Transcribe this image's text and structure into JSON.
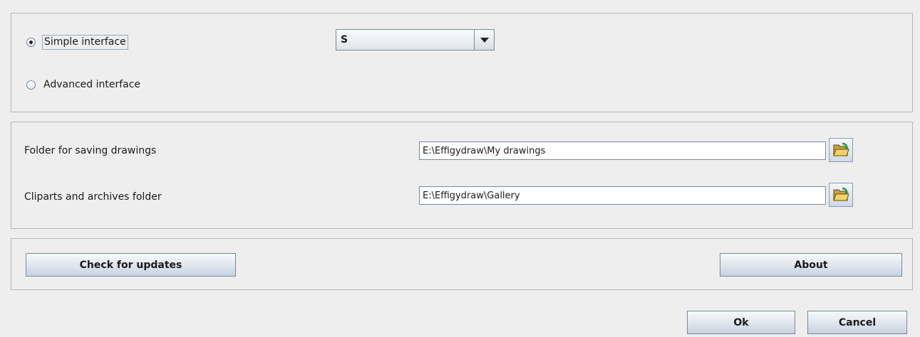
{
  "interface": {
    "simple_label": "Simple interface",
    "advanced_label": "Advanced interface",
    "selected": "simple",
    "size_select": {
      "value": "S"
    }
  },
  "folders": {
    "saving": {
      "label": "Folder for saving drawings",
      "value": "E:\\Effigydraw\\My drawings",
      "browse_icon": "open-folder-icon"
    },
    "cliparts": {
      "label": "Cliparts and archives folder",
      "value": "E:\\Effigydraw\\Gallery",
      "browse_icon": "open-folder-icon"
    }
  },
  "actions": {
    "check_updates_label": "Check for updates",
    "about_label": "About"
  },
  "footer": {
    "ok_label": "Ok",
    "cancel_label": "Cancel"
  }
}
